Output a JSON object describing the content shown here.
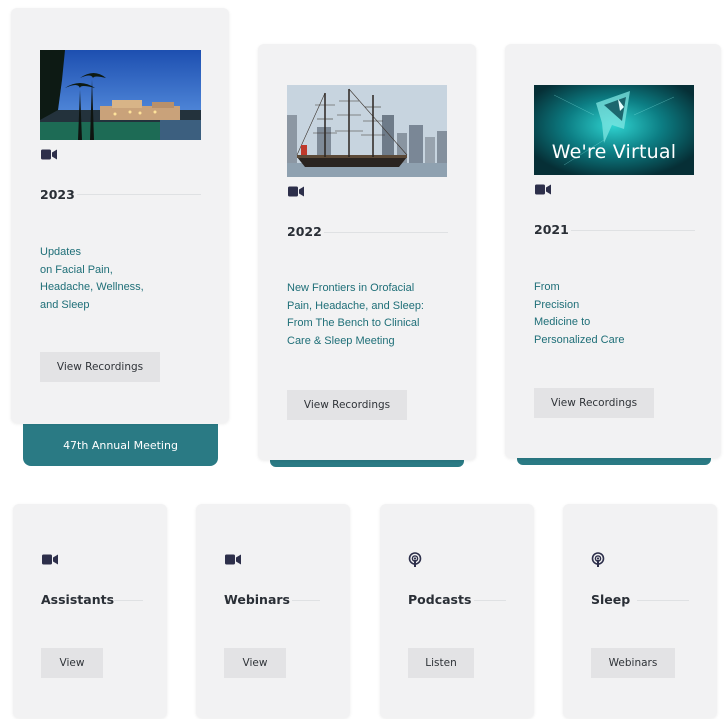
{
  "meetings": [
    {
      "year": "2023",
      "description": "Updates\non Facial Pain,\nHeadache, Wellness,\nand Sleep",
      "button_label": "View Recordings",
      "icon": "video-camera-icon",
      "tab_label": "47th Annual Meeting"
    },
    {
      "year": "2022",
      "description": "New Frontiers in Orofacial\nPain, Headache, and Sleep:\nFrom The Bench to Clinical\nCare & Sleep Meeting",
      "button_label": "View Recordings",
      "icon": "video-camera-icon"
    },
    {
      "year": "2021",
      "description": "From\nPrecision\nMedicine to\nPersonalized Care",
      "button_label": "View Recordings",
      "icon": "video-camera-icon",
      "image_text": "We're Virtual"
    }
  ],
  "resources": [
    {
      "title": "Assistants",
      "button_label": "View",
      "icon": "video-camera-icon"
    },
    {
      "title": "Webinars",
      "button_label": "View",
      "icon": "video-camera-icon"
    },
    {
      "title": "Podcasts",
      "button_label": "Listen",
      "icon": "podcast-icon"
    },
    {
      "title": "Sleep",
      "button_label": "Webinars",
      "icon": "podcast-icon"
    }
  ],
  "colors": {
    "accent": "#2a7a84",
    "card_bg": "#f2f2f3",
    "link_text": "#1f6f78"
  }
}
